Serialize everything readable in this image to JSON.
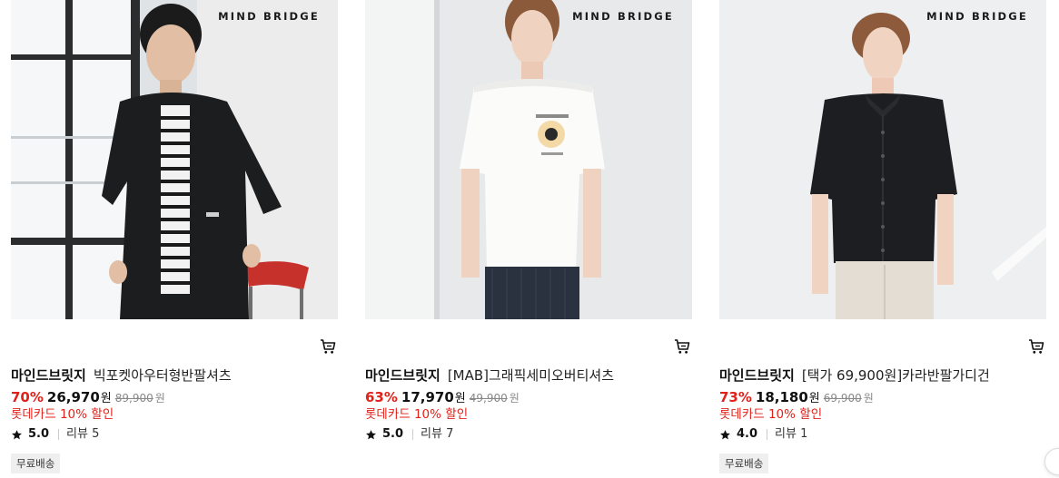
{
  "products": [
    {
      "brand_mark": "MIND BRIDGE",
      "brand": "마인드브릿지",
      "name": "빅포켓아우터형반팔셔츠",
      "discount": "70%",
      "price": "26,970",
      "currency": "원",
      "original_price": "89,900",
      "card_promo": "롯데카드 10% 할인",
      "rating": "5.0",
      "reviews": "리뷰 5",
      "badge": "무료배송",
      "image_icon": "model-photo-black-short-sleeve-shirt"
    },
    {
      "brand_mark": "MIND BRIDGE",
      "brand": "마인드브릿지",
      "name": "[MAB]그래픽세미오버티셔츠",
      "discount": "63%",
      "price": "17,970",
      "currency": "원",
      "original_price": "49,900",
      "card_promo": "롯데카드 10% 할인",
      "rating": "5.0",
      "reviews": "리뷰 7",
      "badge": "",
      "image_icon": "model-photo-white-graphic-tee"
    },
    {
      "brand_mark": "MIND BRIDGE",
      "brand": "마인드브릿지",
      "name": "[택가 69,900원]카라반팔가디건",
      "discount": "73%",
      "price": "18,180",
      "currency": "원",
      "original_price": "69,900",
      "card_promo": "롯데카드 10% 할인",
      "rating": "4.0",
      "reviews": "리뷰 1",
      "badge": "무료배송",
      "image_icon": "model-photo-black-collar-cardigan"
    }
  ],
  "icons": {
    "cart": "cart-icon",
    "star": "star-icon"
  },
  "colors": {
    "discount": "#e0221b",
    "promo": "#e0221b",
    "badge_bg": "#efefef"
  }
}
